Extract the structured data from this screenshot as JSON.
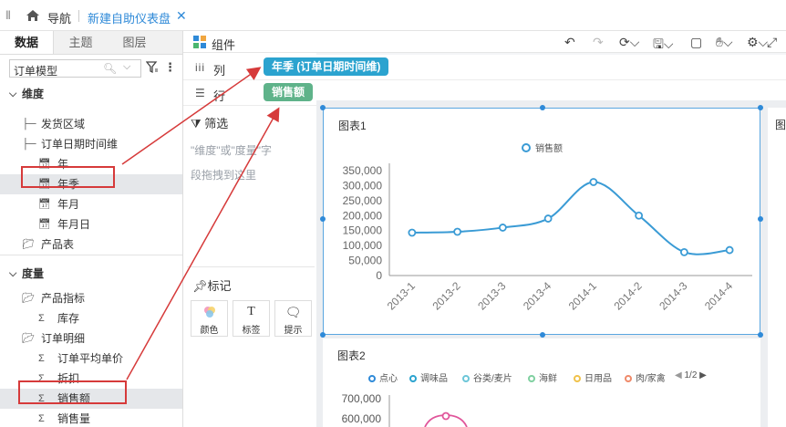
{
  "topbar": {
    "nav_label": "导航",
    "active_tab": "新建自助仪表盘",
    "close_glyph": "✕"
  },
  "left": {
    "tabs": [
      "数据",
      "主题",
      "图层"
    ],
    "model_value": "订单模型",
    "more_glyph": "⋮",
    "tree": [
      {
        "label": "维度",
        "kind": "group",
        "icon": "caret-down-icon"
      },
      {
        "label": "发货区域",
        "kind": "hierarchy",
        "icon": "hierarchy-icon"
      },
      {
        "label": "订单日期时间维",
        "kind": "hierarchy",
        "icon": "hierarchy-icon"
      },
      {
        "label": "年",
        "kind": "date",
        "icon": "date-field-icon"
      },
      {
        "label": "年季",
        "kind": "date",
        "icon": "date-field-icon"
      },
      {
        "label": "年月",
        "kind": "date",
        "icon": "date-field-icon"
      },
      {
        "label": "年月日",
        "kind": "date",
        "icon": "date-field-icon"
      },
      {
        "label": "产品表",
        "kind": "folder",
        "icon": "folder-icon"
      },
      {
        "label": "度量",
        "kind": "group",
        "icon": "caret-down-icon"
      },
      {
        "label": "产品指标",
        "kind": "folder",
        "icon": "folder-open-icon"
      },
      {
        "label": "库存",
        "kind": "measure",
        "icon": "sigma-icon"
      },
      {
        "label": "订单明细",
        "kind": "folder",
        "icon": "folder-open-icon"
      },
      {
        "label": "订单平均单价",
        "kind": "measure",
        "icon": "sigma-icon"
      },
      {
        "label": "折扣",
        "kind": "measure",
        "icon": "sigma-icon"
      },
      {
        "label": "销售额",
        "kind": "measure",
        "icon": "sigma-icon"
      },
      {
        "label": "销售量",
        "kind": "measure",
        "icon": "sigma-icon"
      }
    ]
  },
  "component_bar": {
    "label": "组件"
  },
  "shelves": {
    "columns_label": "列",
    "rows_label": "行",
    "column_pill": "年季 (订单日期时间维)",
    "row_pill": "销售额"
  },
  "filter": {
    "title": "筛选",
    "hint_line1": "\"维度\"或\"度量\"字",
    "hint_line2": "段拖拽到这里"
  },
  "marks": {
    "title": "标记",
    "buttons": [
      {
        "label": "颜色",
        "icon": "color-icon"
      },
      {
        "label": "标签",
        "icon": "label-icon"
      },
      {
        "label": "提示",
        "icon": "tooltip-icon"
      }
    ]
  },
  "colors": {
    "accent": "#2f8ad8",
    "pill_column": "#2ba3cf",
    "pill_row": "#5fb38a",
    "highlight": "#d63a3a",
    "line": "#3a9bd5",
    "pie_pink": "#e0559a"
  },
  "chart1": {
    "title": "图表1",
    "legend": "销售额",
    "chart_data": {
      "type": "line",
      "title": "",
      "categories": [
        "2013-1",
        "2013-2",
        "2013-3",
        "2013-4",
        "2014-1",
        "2014-2",
        "2014-3",
        "2014-4"
      ],
      "series": [
        {
          "name": "销售额",
          "values": [
            143000,
            146000,
            160000,
            190000,
            312000,
            200000,
            78000,
            85000
          ]
        }
      ],
      "yticks": [
        "0",
        "50,000",
        "100,000",
        "150,000",
        "200,000",
        "250,000",
        "300,000",
        "350,000"
      ],
      "ylim": [
        0,
        350000
      ],
      "smooth": true,
      "grid": false,
      "legend_position": "top"
    }
  },
  "chart2": {
    "title": "图表2",
    "legend": [
      {
        "name": "点心",
        "color": "#2f8ad8"
      },
      {
        "name": "调味品",
        "color": "#2ba3cf"
      },
      {
        "name": "谷类/麦片",
        "color": "#6cc6d8"
      },
      {
        "name": "海鲜",
        "color": "#7fd0a0"
      },
      {
        "name": "日用品",
        "color": "#f0c24a"
      },
      {
        "name": "肉/家禽",
        "color": "#ef8a6a"
      }
    ],
    "pager": "1/2",
    "yticks": [
      "700,000",
      "600,000"
    ]
  },
  "chart3": {
    "title": "图"
  }
}
